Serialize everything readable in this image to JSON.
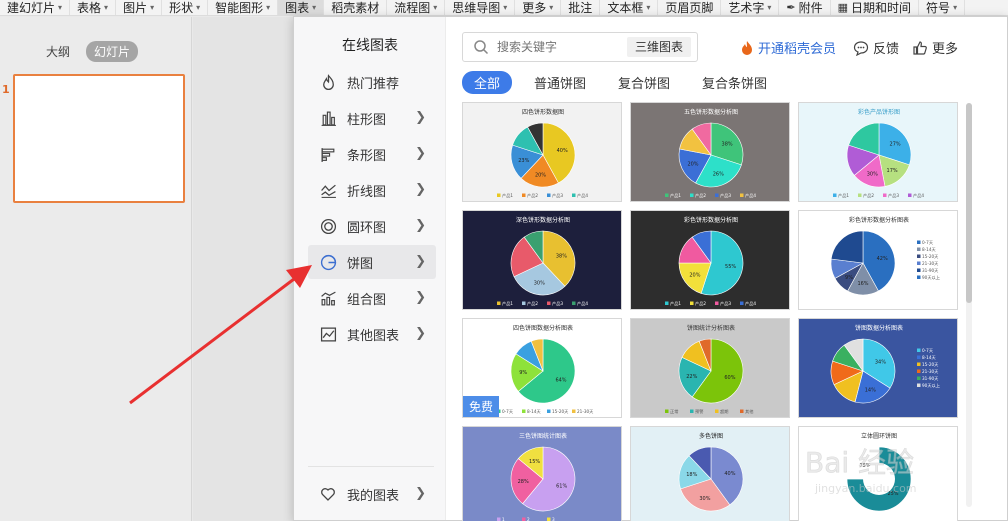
{
  "ribbon": {
    "items": [
      {
        "label": "建幻灯片",
        "caret": true
      },
      {
        "label": "表格",
        "caret": true
      },
      {
        "label": "图片",
        "caret": true
      },
      {
        "label": "形状",
        "caret": true
      },
      {
        "label": "智能图形",
        "caret": true
      },
      {
        "label": "图表",
        "caret": true,
        "active": true
      },
      {
        "label": "稻壳素材",
        "caret": false
      },
      {
        "label": "流程图",
        "caret": true
      },
      {
        "label": "思维导图",
        "caret": true
      },
      {
        "label": "更多",
        "caret": true
      },
      {
        "label": "批注",
        "caret": false
      },
      {
        "label": "文本框",
        "caret": true
      },
      {
        "label": "页眉页脚",
        "caret": false
      },
      {
        "label": "艺术字",
        "caret": true
      },
      {
        "label": "附件",
        "caret": false,
        "icon": "paperclip-icon"
      },
      {
        "label": "日期和时间",
        "caret": false,
        "icon": "calendar-icon"
      },
      {
        "label": "符号",
        "caret": true
      }
    ]
  },
  "left_panel": {
    "tab_outline": "大纲",
    "tab_slides": "幻灯片",
    "slide_number": "1"
  },
  "popup": {
    "title": "在线图表",
    "categories": [
      {
        "label": "热门推荐",
        "icon": "flame-icon",
        "arrow": false
      },
      {
        "label": "柱形图",
        "icon": "bar-chart-icon",
        "arrow": true
      },
      {
        "label": "条形图",
        "icon": "horizontal-bar-icon",
        "arrow": true
      },
      {
        "label": "折线图",
        "icon": "line-chart-icon",
        "arrow": true
      },
      {
        "label": "圆环图",
        "icon": "donut-icon",
        "arrow": true
      },
      {
        "label": "饼图",
        "icon": "pie-icon",
        "arrow": true,
        "active": true
      },
      {
        "label": "组合图",
        "icon": "combo-chart-icon",
        "arrow": true
      },
      {
        "label": "其他图表",
        "icon": "other-chart-icon",
        "arrow": true
      }
    ],
    "my_charts": "我的图表",
    "search": {
      "placeholder": "搜索关键字",
      "tag": "三维图表"
    },
    "vip": "开通稻壳会员",
    "feedback": "反馈",
    "more": "更多",
    "filters": [
      "全部",
      "普通饼图",
      "复合饼图",
      "复合条饼图"
    ],
    "active_filter": 0,
    "free_badge": "免费",
    "cards": [
      {
        "title": "四色饼形数据图",
        "bg": "#f2f2f2",
        "title_color": "#333333",
        "slices": [
          [
            0.42,
            "#e8c822"
          ],
          [
            0.2,
            "#f08a24"
          ],
          [
            0.18,
            "#3a8fd6"
          ],
          [
            0.12,
            "#2ec0b0"
          ],
          [
            0.08,
            "#333333"
          ]
        ],
        "labels": [
          "40%",
          "20%",
          "23%"
        ],
        "legend": [
          "产品1",
          "产品2",
          "产品3",
          "产品4"
        ]
      },
      {
        "title": "五色饼形数据分析图",
        "bg": "#7b7574",
        "title_color": "#ffffff",
        "slices": [
          [
            0.3,
            "#3fc47a"
          ],
          [
            0.28,
            "#2de0c9"
          ],
          [
            0.2,
            "#3b6fd6"
          ],
          [
            0.12,
            "#f2c240"
          ],
          [
            0.1,
            "#f06aa0"
          ]
        ],
        "labels": [
          "38%",
          "26%",
          "20%"
        ],
        "legend": [
          "产品1",
          "产品2",
          "产品3",
          "产品4"
        ]
      },
      {
        "title": "彩色产品饼形图",
        "bg": "#e8f6fa",
        "title_color": "#3a9fc9",
        "slices": [
          [
            0.3,
            "#3cb0e8"
          ],
          [
            0.17,
            "#b6e080"
          ],
          [
            0.17,
            "#f06ac8"
          ],
          [
            0.16,
            "#b05cd6"
          ],
          [
            0.2,
            "#2ec8a0"
          ]
        ],
        "labels": [
          "27%",
          "17%",
          "30%"
        ],
        "legend": [
          "产品1",
          "产品2",
          "产品3",
          "产品4"
        ]
      },
      {
        "title": "深色饼形数据分析图",
        "bg": "#1d1f3c",
        "title_color": "#ffffff",
        "slices": [
          [
            0.38,
            "#e8c030"
          ],
          [
            0.3,
            "#a6c8e0"
          ],
          [
            0.22,
            "#e85a6a"
          ],
          [
            0.1,
            "#3aa070"
          ]
        ],
        "labels": [
          "38%",
          "30%"
        ],
        "legend": [
          "产品1",
          "产品2",
          "产品3",
          "产品4"
        ]
      },
      {
        "title": "彩色饼形数据分析图",
        "bg": "#2d2d2d",
        "title_color": "#ffffff",
        "slices": [
          [
            0.55,
            "#2ec8d0"
          ],
          [
            0.2,
            "#f2e03a"
          ],
          [
            0.15,
            "#f05aa0"
          ],
          [
            0.1,
            "#3a6fd6"
          ]
        ],
        "labels": [
          "55%",
          "20%"
        ],
        "legend": [
          "产品1",
          "产品2",
          "产品3",
          "产品4"
        ]
      },
      {
        "title": "彩色饼形数据分析图表",
        "bg": "#ffffff",
        "title_color": "#333333",
        "slices": [
          [
            0.42,
            "#2a6fc0"
          ],
          [
            0.16,
            "#7f8fa8"
          ],
          [
            0.09,
            "#3a4c80"
          ],
          [
            0.1,
            "#5a7fd0"
          ],
          [
            0.23,
            "#1f4a90"
          ]
        ],
        "labels": [
          "42%",
          "16%",
          "9%"
        ],
        "legend": [
          "0-7天",
          "8-14天",
          "15-20天",
          "21-30天",
          "31-90天",
          "90天以上"
        ]
      },
      {
        "title": "四色饼图数据分析图表",
        "bg": "#ffffff",
        "title_color": "#333333",
        "slices": [
          [
            0.64,
            "#2ec88a"
          ],
          [
            0.2,
            "#8ee23a"
          ],
          [
            0.1,
            "#3aa0e0"
          ],
          [
            0.06,
            "#f0c040"
          ]
        ],
        "labels": [
          "64%",
          "9%"
        ],
        "legend": [
          "0-7天",
          "8-14天",
          "15-20天",
          "21-30天"
        ]
      },
      {
        "title": "饼图统计分析图表",
        "bg": "#c9c9c9",
        "title_color": "#333333",
        "slices": [
          [
            0.6,
            "#7cc40a"
          ],
          [
            0.22,
            "#2ab5b0"
          ],
          [
            0.12,
            "#f0c020"
          ],
          [
            0.06,
            "#e06a2a"
          ]
        ],
        "labels": [
          "60%",
          "22%"
        ],
        "legend": [
          "正常",
          "预警",
          "超期",
          "其他"
        ]
      },
      {
        "title": "饼图数据分析图表",
        "bg": "#3a55a0",
        "title_color": "#ffffff",
        "slices": [
          [
            0.34,
            "#40c8e8"
          ],
          [
            0.2,
            "#3a6fd6"
          ],
          [
            0.14,
            "#f0c020"
          ],
          [
            0.12,
            "#f06a1a"
          ],
          [
            0.1,
            "#3ab060"
          ],
          [
            0.1,
            "#e0e0e0"
          ]
        ],
        "labels": [
          "34%",
          "14%"
        ],
        "legend": [
          "0-7天",
          "8-14天",
          "15-20天",
          "21-30天",
          "31-90天",
          "90天以上"
        ]
      },
      {
        "title": "三色饼图统计图表",
        "bg": "#7a8ac8",
        "title_color": "#ffffff",
        "slices": [
          [
            0.61,
            "#c8a0f0"
          ],
          [
            0.25,
            "#f060a0"
          ],
          [
            0.14,
            "#f0e040"
          ]
        ],
        "labels": [
          "61%",
          "28%",
          "15%"
        ],
        "legend": [
          "1",
          "2",
          "3"
        ]
      },
      {
        "title": "多色饼图",
        "bg": "#e2f0f5",
        "title_color": "#222222",
        "slices": [
          [
            0.4,
            "#7a8ad0"
          ],
          [
            0.3,
            "#f2a0a0"
          ],
          [
            0.18,
            "#8ad8e8"
          ],
          [
            0.12,
            "#4a5ab0"
          ]
        ],
        "labels": [
          "40%",
          "30%",
          "18%"
        ],
        "legend": []
      },
      {
        "title": "立体圆环饼图",
        "bg": "#ffffff",
        "title_color": "#333333",
        "slices": [
          [
            0.75,
            "#1a8c98"
          ],
          [
            0.25,
            "#ffffff"
          ]
        ],
        "labels": [
          "25%",
          "75%"
        ],
        "legend": []
      }
    ]
  },
  "watermark": {
    "text": "Bai 经验",
    "subtext": "jingyan.baidu.com"
  },
  "colors": {
    "accent": "#3d7be8",
    "vip": "#e8671a",
    "annotation": "#e83030",
    "slide_border": "#e9803f"
  }
}
